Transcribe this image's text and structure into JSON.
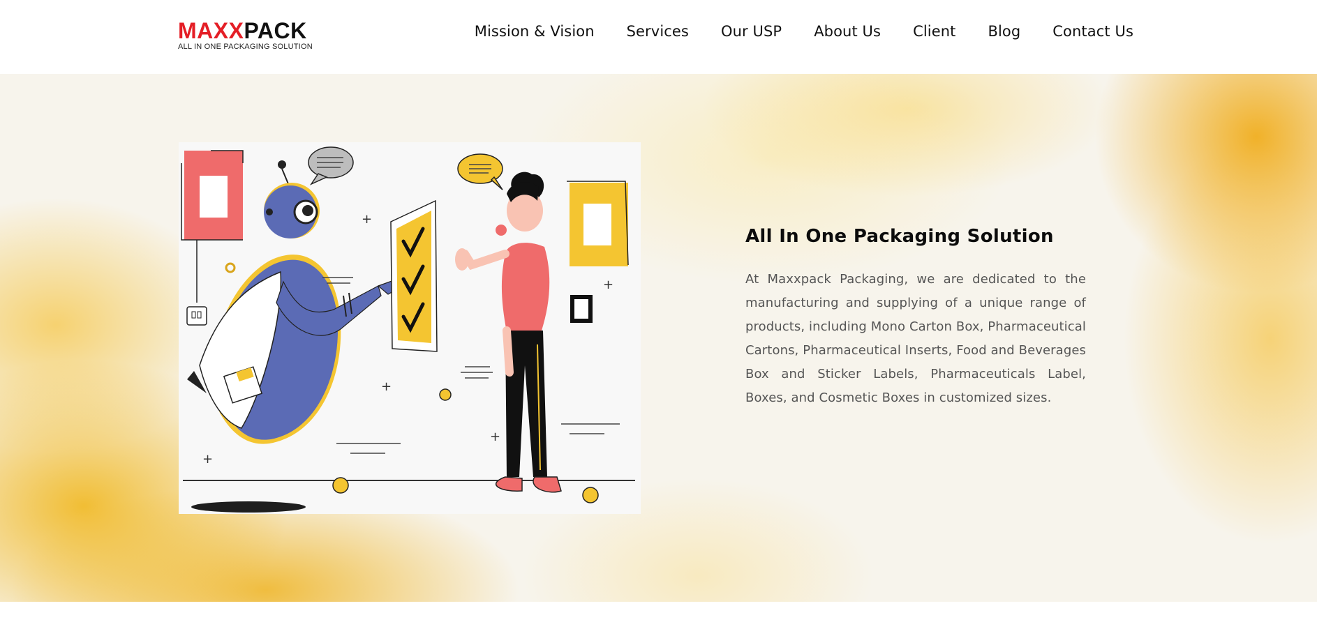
{
  "brand": {
    "logo_red": "MAXX",
    "logo_black": "PACK",
    "tagline": "ALL IN ONE PACKAGING SOLUTION",
    "colors": {
      "red": "#e41e26",
      "black": "#111111",
      "accent_yellow": "#f4c531",
      "illustration_blue": "#5b6bb5",
      "illustration_coral": "#ef6b6b"
    }
  },
  "nav": {
    "items": [
      {
        "label": "Mission & Vision"
      },
      {
        "label": "Services"
      },
      {
        "label": "Our USP"
      },
      {
        "label": "About Us"
      },
      {
        "label": "Client"
      },
      {
        "label": "Blog"
      },
      {
        "label": "Contact Us"
      }
    ]
  },
  "hero": {
    "title": "All In One Packaging Solution",
    "description": "At Maxxpack Packaging, we are dedicated to the manufacturing and supplying of a unique range of products, including Mono Carton Box, Pharmaceutical Cartons, Pharmaceutical Inserts, Food and Beverages Box and Sticker Labels, Pharmaceuticals Label, Boxes, and Cosmetic Boxes in customized sizes.",
    "illustration": "robot-and-person-checklist-illustration"
  }
}
